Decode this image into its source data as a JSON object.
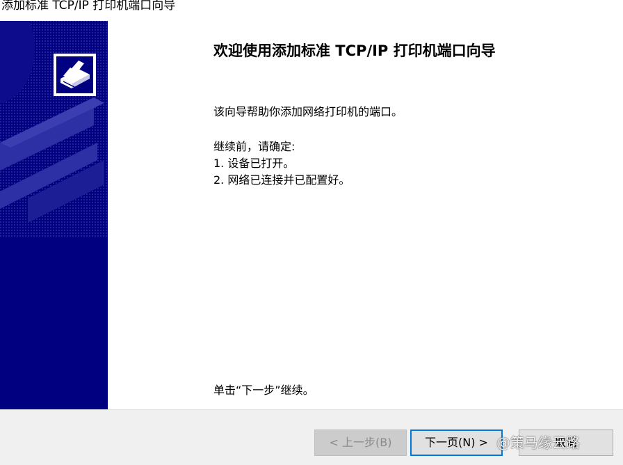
{
  "window": {
    "title": "添加标准 TCP/IP 打印机端口向导"
  },
  "content": {
    "heading": "欢迎使用添加标准 TCP/IP 打印机端口向导",
    "intro": "该向导帮助你添加网络打印机的端口。",
    "before_label": "继续前，请确定:",
    "steps": [
      "1.  设备已打开。",
      "2.  网络已连接并已配置好。"
    ],
    "footer_note": "单击“下一步”继续。"
  },
  "buttons": {
    "back": "< 上一步(B)",
    "next": "下一页(N) >",
    "cancel": "取消"
  },
  "watermark": "@策马缘云路",
  "colors": {
    "banner": "#000080",
    "next_button_border": "#0078d7",
    "footer_bg": "#f0f0f0"
  },
  "icons": {
    "wizard": "printer-wizard-icon"
  }
}
